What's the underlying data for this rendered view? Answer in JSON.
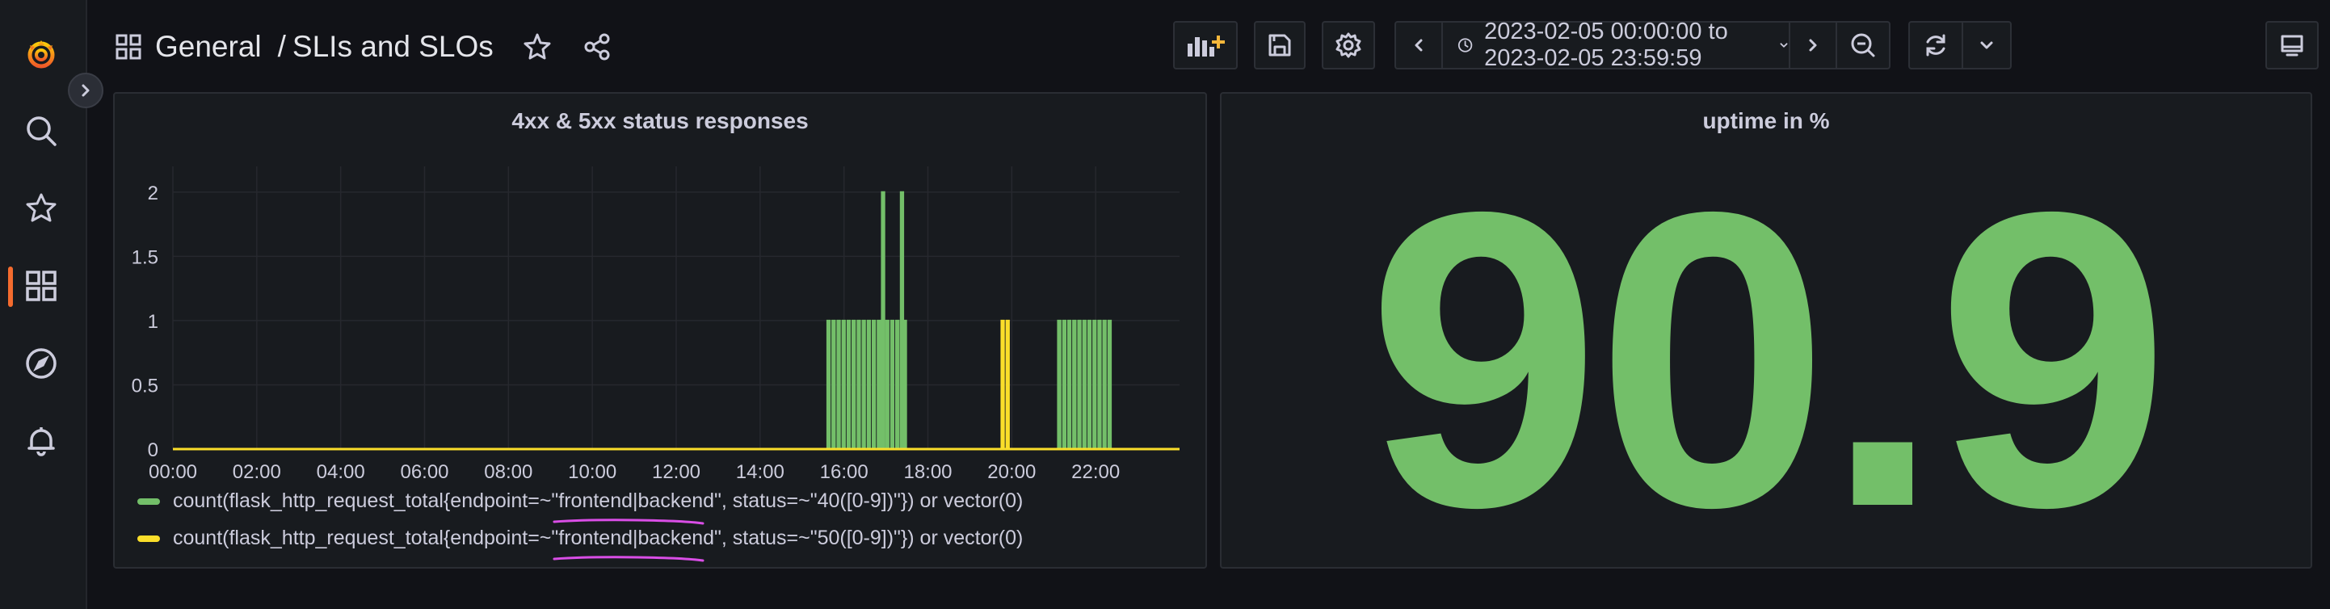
{
  "breadcrumb": {
    "folder": "General",
    "separator": "/",
    "dashboard": "SLIs and SLOs"
  },
  "toolbar": {
    "time_range": "2023-02-05 00:00:00 to 2023-02-05 23:59:59"
  },
  "panels": [
    {
      "title": "4xx & 5xx status responses",
      "legend": [
        {
          "label": "count(flask_http_request_total{endpoint=~\"frontend|backend\", status=~\"40([0-9])\"}) or vector(0)",
          "color": "#73bf69"
        },
        {
          "label": "count(flask_http_request_total{endpoint=~\"frontend|backend\", status=~\"50([0-9])\"}) or vector(0)",
          "color": "#fade2a"
        }
      ]
    },
    {
      "title": "uptime in %",
      "value": "90.9",
      "value_color": "#73bf69"
    }
  ],
  "chart_data": {
    "type": "line",
    "title": "4xx & 5xx status responses",
    "x_ticks": [
      "00:00",
      "02:00",
      "04:00",
      "06:00",
      "08:00",
      "10:00",
      "12:00",
      "14:00",
      "16:00",
      "18:00",
      "20:00",
      "22:00"
    ],
    "y_ticks": [
      "0",
      "0.5",
      "1",
      "1.5",
      "2"
    ],
    "ylim": [
      0,
      2.2
    ],
    "xlim_hours": [
      0,
      24
    ],
    "series": [
      {
        "name": "count(flask_http_request_total{endpoint=~\"frontend|backend\", status=~\"40([0-9])\"}) or vector(0)",
        "color": "#73bf69",
        "bursts": [
          {
            "start": 15.6,
            "end": 16.9,
            "value": 1
          },
          {
            "start": 16.9,
            "end": 17.0,
            "value": 2
          },
          {
            "start": 17.0,
            "end": 17.35,
            "value": 1
          },
          {
            "start": 17.35,
            "end": 17.42,
            "value": 2
          },
          {
            "start": 17.42,
            "end": 17.5,
            "value": 1
          },
          {
            "start": 21.1,
            "end": 22.4,
            "value": 1
          }
        ]
      },
      {
        "name": "count(flask_http_request_total{endpoint=~\"frontend|backend\", status=~\"50([0-9])\"}) or vector(0)",
        "color": "#fade2a",
        "bursts": [
          {
            "start": 19.75,
            "end": 19.95,
            "value": 1
          }
        ]
      }
    ]
  },
  "annotation": {
    "color": "#d94ee6"
  }
}
